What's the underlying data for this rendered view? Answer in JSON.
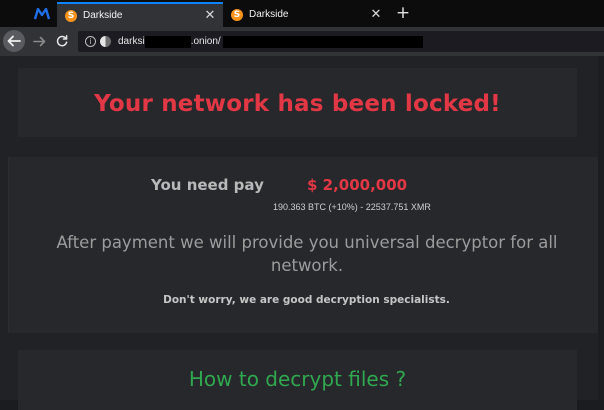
{
  "browser": {
    "tabs": [
      {
        "title": "Darkside",
        "favicon": "S",
        "active": true
      },
      {
        "title": "Darkside",
        "favicon": "S",
        "active": false
      }
    ],
    "close_glyph": "✕",
    "new_tab_glyph": "+",
    "url": {
      "prefix": "darksi",
      "middle": ".onion/"
    },
    "colors": {
      "accent": "#0a84ff",
      "favicon": "#f7931a"
    },
    "icons": [
      "extension-m-icon",
      "back-arrow-icon",
      "forward-arrow-icon",
      "reload-icon",
      "info-icon",
      "onion-icon",
      "close-icon",
      "new-tab-icon"
    ]
  },
  "page": {
    "headline": "Your network has been locked!",
    "pay_label": "You need pay",
    "pay_amount": "$ 2,000,000",
    "pay_crypto": "190.363 BTC (+10%) - 22537.751 XMR",
    "after_payment": "After payment we will provide you universal decryptor for all network.",
    "reassurance": "Don't worry, we are good decryption specialists.",
    "decrypt_heading": "How to decrypt files ?",
    "colors": {
      "headline": "#e23744",
      "decrypt_heading": "#2fa84f"
    }
  }
}
